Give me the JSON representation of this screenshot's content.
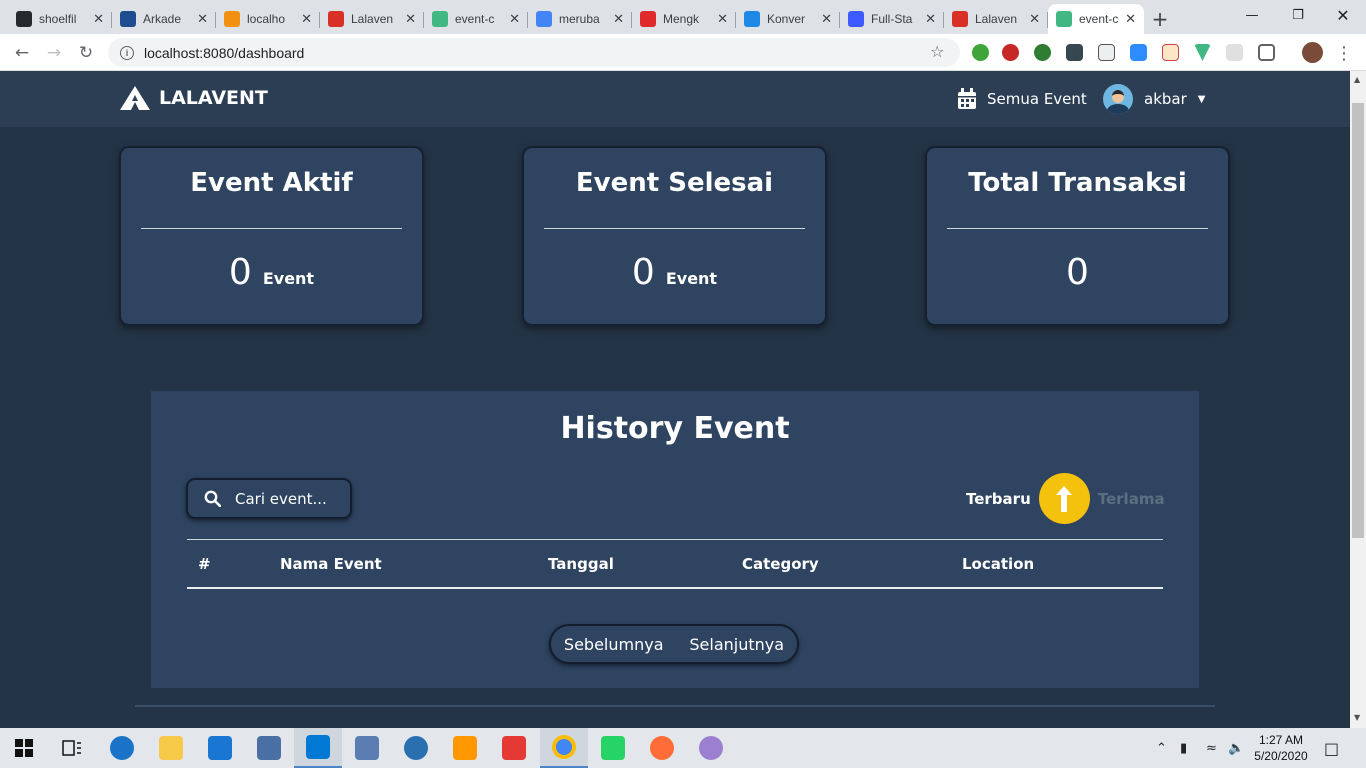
{
  "browser": {
    "tabs": [
      {
        "title": "shoelfil",
        "icon": "github-icon",
        "color": "#24292e"
      },
      {
        "title": "Arkade",
        "icon": "arkademy-icon",
        "color": "#1d4d8f"
      },
      {
        "title": "localho",
        "icon": "phpmyadmin-icon",
        "color": "#f29111"
      },
      {
        "title": "Lalaven",
        "icon": "gmail-icon",
        "color": "#d93025"
      },
      {
        "title": "event-c",
        "icon": "vue-icon",
        "color": "#41b883"
      },
      {
        "title": "meruba",
        "icon": "google-icon",
        "color": "#4285f4"
      },
      {
        "title": "Mengk",
        "icon": "opera-icon",
        "color": "#e0292b"
      },
      {
        "title": "Konver",
        "icon": "doc-icon",
        "color": "#1e88e5"
      },
      {
        "title": "Full-Sta",
        "icon": "app-icon",
        "color": "#3d5afe"
      },
      {
        "title": "Lalaven",
        "icon": "gmail-icon",
        "color": "#d93025"
      },
      {
        "title": "event-c",
        "icon": "vue-icon",
        "color": "#41b883"
      }
    ],
    "url": "localhost:8080/dashboard"
  },
  "navbar": {
    "brand": "LALAVENT",
    "events_link": "Semua Event",
    "username": "akbar"
  },
  "stats": [
    {
      "title": "Event Aktif",
      "value": "0",
      "unit": "Event"
    },
    {
      "title": "Event Selesai",
      "value": "0",
      "unit": "Event"
    },
    {
      "title": "Total Transaksi",
      "value": "0",
      "unit": ""
    }
  ],
  "history": {
    "title": "History Event",
    "search_placeholder": "Cari event...",
    "sort_newest": "Terbaru",
    "sort_oldest": "Terlama",
    "columns": [
      "#",
      "Nama Event",
      "Tanggal",
      "Category",
      "Location"
    ],
    "prev": "Sebelumnya",
    "next": "Selanjutnya"
  },
  "taskbar": {
    "time": "1:27 AM",
    "date": "5/20/2020"
  },
  "colors": {
    "background": "#243447",
    "card": "#2e4460",
    "accent": "#f4c20d"
  }
}
